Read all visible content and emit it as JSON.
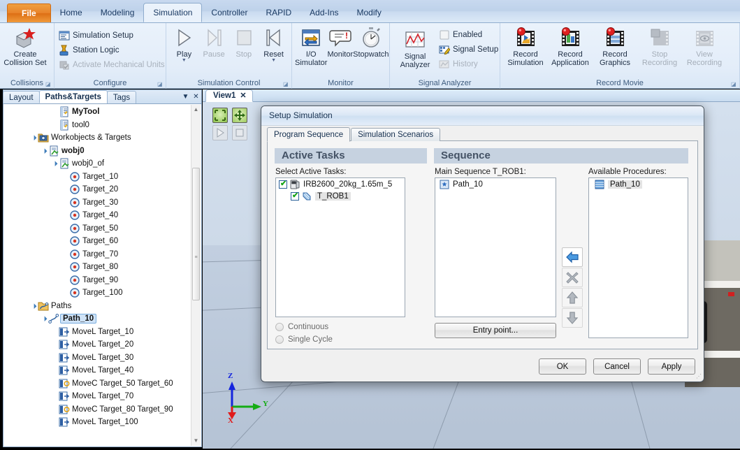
{
  "ribbon": {
    "tabs": [
      {
        "label": "File",
        "kind": "file"
      },
      {
        "label": "Home",
        "kind": "normal"
      },
      {
        "label": "Modeling",
        "kind": "normal"
      },
      {
        "label": "Simulation",
        "kind": "active"
      },
      {
        "label": "Controller",
        "kind": "normal"
      },
      {
        "label": "RAPID",
        "kind": "normal"
      },
      {
        "label": "Add-Ins",
        "kind": "normal"
      },
      {
        "label": "Modify",
        "kind": "normal"
      }
    ],
    "groups": [
      {
        "title": "Collisions",
        "dialog_launcher": "◪",
        "big": [
          {
            "label": "Create\nCollision Set",
            "icon": "create-collision-set-icon",
            "enabled": true
          }
        ],
        "small": []
      },
      {
        "title": "Configure",
        "dialog_launcher": "◪",
        "big": [],
        "small": [
          {
            "label": "Simulation Setup",
            "icon": "simulation-setup-icon",
            "enabled": true
          },
          {
            "label": "Station Logic",
            "icon": "station-logic-icon",
            "enabled": true
          },
          {
            "label": "Activate Mechanical Units",
            "icon": "activate-mechanical-units-icon",
            "enabled": false
          }
        ]
      },
      {
        "title": "Simulation Control",
        "dialog_launcher": "◪",
        "big": [
          {
            "label": "Play",
            "icon": "play-icon",
            "enabled": true,
            "caret": true
          },
          {
            "label": "Pause",
            "icon": "pause-icon",
            "enabled": false
          },
          {
            "label": "Stop",
            "icon": "stop-icon",
            "enabled": false
          },
          {
            "label": "Reset",
            "icon": "reset-icon",
            "enabled": true,
            "caret": true
          }
        ],
        "small": []
      },
      {
        "title": "Monitor",
        "dialog_launcher": "",
        "big": [
          {
            "label": "I/O\nSimulator",
            "icon": "io-simulator-icon",
            "enabled": true
          },
          {
            "label": "Monitor",
            "icon": "monitor-icon",
            "enabled": true
          },
          {
            "label": "Stopwatch",
            "icon": "stopwatch-icon",
            "enabled": true
          }
        ],
        "small": []
      },
      {
        "title": "Signal Analyzer",
        "dialog_launcher": "",
        "big": [
          {
            "label": "Signal\nAnalyzer",
            "icon": "signal-analyzer-icon",
            "enabled": true
          }
        ],
        "small": [
          {
            "label": "Enabled",
            "icon": "enabled-checkbox-icon",
            "enabled": true
          },
          {
            "label": "Signal Setup",
            "icon": "signal-setup-icon",
            "enabled": true
          },
          {
            "label": "History",
            "icon": "history-icon",
            "enabled": false
          }
        ]
      },
      {
        "title": "Record Movie",
        "dialog_launcher": "◪",
        "big": [
          {
            "label": "Record\nSimulation",
            "icon": "record-simulation-icon",
            "enabled": true
          },
          {
            "label": "Record\nApplication",
            "icon": "record-application-icon",
            "enabled": true
          },
          {
            "label": "Record\nGraphics",
            "icon": "record-graphics-icon",
            "enabled": true
          },
          {
            "label": "Stop\nRecording",
            "icon": "stop-recording-icon",
            "enabled": false
          },
          {
            "label": "View\nRecording",
            "icon": "view-recording-icon",
            "enabled": false
          }
        ],
        "small": []
      }
    ]
  },
  "browser": {
    "tabs": [
      {
        "label": "Layout",
        "active": false
      },
      {
        "label": "Paths&Targets",
        "active": true
      },
      {
        "label": "Tags",
        "active": false
      }
    ],
    "menu_icon": "chevron-down-icon",
    "close_icon": "close-icon",
    "tree": [
      {
        "label": "MyTool",
        "indent": 4,
        "icon": "tool-icon",
        "expander": "",
        "bold": true,
        "selected": false
      },
      {
        "label": "tool0",
        "indent": 4,
        "icon": "tool-icon",
        "expander": "",
        "bold": false,
        "selected": false
      },
      {
        "label": "Workobjects & Targets",
        "indent": 2,
        "icon": "workobjects-folder-icon",
        "expander": "▲",
        "bold": false,
        "selected": false
      },
      {
        "label": "wobj0",
        "indent": 3,
        "icon": "workobject-icon",
        "expander": "▲",
        "bold": true,
        "selected": false
      },
      {
        "label": "wobj0_of",
        "indent": 4,
        "icon": "workobject-icon",
        "expander": "▲",
        "bold": false,
        "selected": false
      },
      {
        "label": "Target_10",
        "indent": 5,
        "icon": "target-icon",
        "expander": "",
        "bold": false,
        "selected": false
      },
      {
        "label": "Target_20",
        "indent": 5,
        "icon": "target-icon",
        "expander": "",
        "bold": false,
        "selected": false
      },
      {
        "label": "Target_30",
        "indent": 5,
        "icon": "target-icon",
        "expander": "",
        "bold": false,
        "selected": false
      },
      {
        "label": "Target_40",
        "indent": 5,
        "icon": "target-icon",
        "expander": "",
        "bold": false,
        "selected": false
      },
      {
        "label": "Target_50",
        "indent": 5,
        "icon": "target-icon",
        "expander": "",
        "bold": false,
        "selected": false
      },
      {
        "label": "Target_60",
        "indent": 5,
        "icon": "target-icon",
        "expander": "",
        "bold": false,
        "selected": false
      },
      {
        "label": "Target_70",
        "indent": 5,
        "icon": "target-icon",
        "expander": "",
        "bold": false,
        "selected": false
      },
      {
        "label": "Target_80",
        "indent": 5,
        "icon": "target-icon",
        "expander": "",
        "bold": false,
        "selected": false
      },
      {
        "label": "Target_90",
        "indent": 5,
        "icon": "target-icon",
        "expander": "",
        "bold": false,
        "selected": false
      },
      {
        "label": "Target_100",
        "indent": 5,
        "icon": "target-icon",
        "expander": "",
        "bold": false,
        "selected": false
      },
      {
        "label": "Paths",
        "indent": 2,
        "icon": "paths-folder-icon",
        "expander": "▲",
        "bold": false,
        "selected": false
      },
      {
        "label": "Path_10",
        "indent": 3,
        "icon": "path-icon",
        "expander": "▲",
        "bold": true,
        "selected": true
      },
      {
        "label": "MoveL Target_10",
        "indent": 4,
        "icon": "movel-icon",
        "expander": "",
        "bold": false,
        "selected": false
      },
      {
        "label": "MoveL Target_20",
        "indent": 4,
        "icon": "movel-icon",
        "expander": "",
        "bold": false,
        "selected": false
      },
      {
        "label": "MoveL Target_30",
        "indent": 4,
        "icon": "movel-icon",
        "expander": "",
        "bold": false,
        "selected": false
      },
      {
        "label": "MoveL Target_40",
        "indent": 4,
        "icon": "movel-icon",
        "expander": "",
        "bold": false,
        "selected": false
      },
      {
        "label": "MoveC Target_50 Target_60",
        "indent": 4,
        "icon": "movec-icon",
        "expander": "",
        "bold": false,
        "selected": false
      },
      {
        "label": "MoveL Target_70",
        "indent": 4,
        "icon": "movel-icon",
        "expander": "",
        "bold": false,
        "selected": false
      },
      {
        "label": "MoveC Target_80 Target_90",
        "indent": 4,
        "icon": "movec-icon",
        "expander": "",
        "bold": false,
        "selected": false
      },
      {
        "label": "MoveL Target_100",
        "indent": 4,
        "icon": "movel-icon",
        "expander": "",
        "bold": false,
        "selected": false
      }
    ]
  },
  "viewport": {
    "tab_label": "View1",
    "tab_close": "✕",
    "toolbar": [
      {
        "name": "show-selected-icon",
        "enabled": true
      },
      {
        "name": "zoom-all-icon",
        "enabled": true
      },
      {
        "name": "play-simulation-icon",
        "enabled": false
      },
      {
        "name": "stop-simulation-icon",
        "enabled": false
      }
    ],
    "axes": {
      "x": "X",
      "y": "Y",
      "z": "Z",
      "x_color": "#e01b1b",
      "y_color": "#15ac15",
      "z_color": "#1525dd"
    }
  },
  "dialog": {
    "title": "Setup Simulation",
    "tabs": [
      {
        "label": "Program Sequence",
        "active": true
      },
      {
        "label": "Simulation Scenarios",
        "active": false
      }
    ],
    "active_tasks": {
      "heading": "Active Tasks",
      "list_label": "Select Active Tasks:",
      "items": [
        {
          "label": "IRB2600_20kg_1.65m_5",
          "indent": 0,
          "checked": true,
          "icon": "controller-icon",
          "selected": false
        },
        {
          "label": "T_ROB1",
          "indent": 1,
          "checked": true,
          "icon": "task-icon",
          "selected": true
        }
      ],
      "radios": [
        {
          "label": "Continuous",
          "selected": false,
          "enabled": false
        },
        {
          "label": "Single Cycle",
          "selected": false,
          "enabled": false
        }
      ]
    },
    "sequence": {
      "heading": "Sequence",
      "main_label": "Main Sequence T_ROB1:",
      "main_items": [
        {
          "label": "Path_10",
          "icon": "procedure-icon"
        }
      ],
      "entry_point_button": "Entry point...",
      "available_label": "Available Procedures:",
      "available_items": [
        {
          "label": "Path_10",
          "icon": "procedure-icon",
          "selected": true
        }
      ],
      "transfer_buttons": [
        {
          "name": "move-left-button",
          "glyph": "arrow-left-icon",
          "enabled": true
        },
        {
          "name": "remove-button",
          "glyph": "close-x-icon",
          "enabled": false
        },
        {
          "name": "move-up-button",
          "glyph": "arrow-up-icon",
          "enabled": false
        },
        {
          "name": "move-down-button",
          "glyph": "arrow-down-icon",
          "enabled": false
        }
      ]
    },
    "footer": {
      "ok": "OK",
      "cancel": "Cancel",
      "apply": "Apply"
    }
  },
  "colors": {
    "accent_orange": "#e8822a",
    "ribbon_blue": "#c8d9ef",
    "selection_blue": "#cfe3f7",
    "header_grey": "#c6d2e0"
  }
}
